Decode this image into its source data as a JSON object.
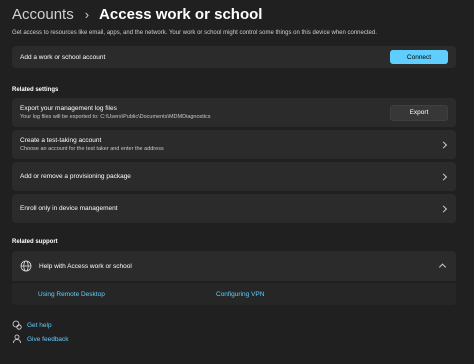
{
  "breadcrumb": {
    "parent": "Accounts",
    "separator": "›",
    "current": "Access work or school"
  },
  "description": "Get access to resources like email, apps, and the network. Your work or school might control some things on this device when connected.",
  "add_account": {
    "label": "Add a work or school account",
    "button": "Connect"
  },
  "related_settings": {
    "heading": "Related settings",
    "export_logs": {
      "title": "Export your management log files",
      "subtitle": "Your log files will be exported to: C:\\Users\\Public\\Documents\\MDMDiagnostics",
      "button": "Export"
    },
    "test_account": {
      "title": "Create a test-taking account",
      "subtitle": "Choose an account for the test taker and enter the address"
    },
    "provisioning": {
      "title": "Add or remove a provisioning package"
    },
    "device_mgmt": {
      "title": "Enroll only in device management"
    }
  },
  "related_support": {
    "heading": "Related support",
    "expander_title": "Help with Access work or school",
    "links": [
      "Using Remote Desktop",
      "Configuring VPN"
    ]
  },
  "footer": {
    "get_help": "Get help",
    "feedback": "Give feedback"
  },
  "colors": {
    "accent": "#60cdff",
    "background": "#202020",
    "card": "#2b2b2b"
  },
  "icons": [
    "globe-icon",
    "help-icon",
    "feedback-icon",
    "chevron-right-icon",
    "chevron-up-icon"
  ]
}
